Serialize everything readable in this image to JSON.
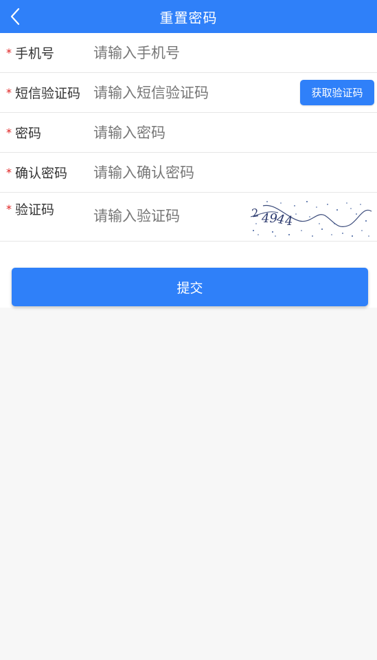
{
  "header": {
    "title": "重置密码",
    "back_icon": "chevron-left-icon"
  },
  "form": {
    "required_mark": "*",
    "phone": {
      "label": "手机号",
      "placeholder": "请输入手机号"
    },
    "sms_code": {
      "label": "短信验证码",
      "placeholder": "请输入短信验证码",
      "button_label": "获取验证码"
    },
    "password": {
      "label": "密码",
      "placeholder": "请输入密码"
    },
    "confirm_password": {
      "label": "确认密码",
      "placeholder": "请输入确认密码"
    },
    "captcha": {
      "label": "验证码",
      "placeholder": "请输入验证码",
      "image_icon": "captcha-image"
    }
  },
  "submit": {
    "label": "提交"
  },
  "colors": {
    "primary": "#2f80f9",
    "required": "#e0201f",
    "background": "#f7f7f7"
  }
}
